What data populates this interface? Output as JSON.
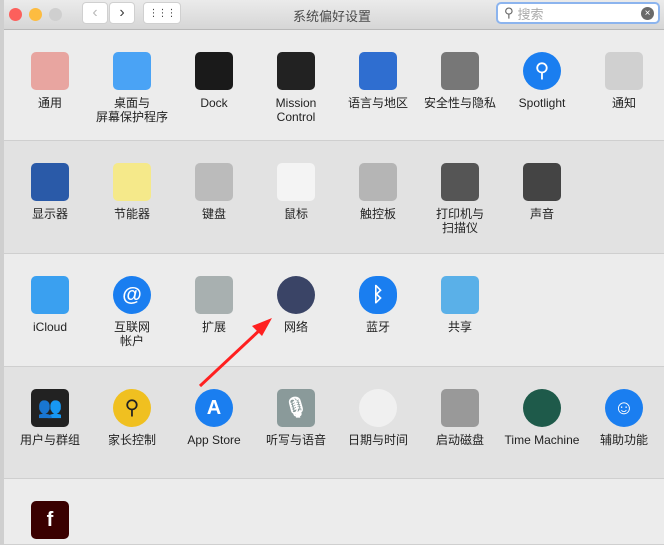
{
  "window": {
    "title": "系统偏好设置",
    "search_placeholder": "搜索",
    "back": "‹",
    "forward": "›",
    "grid": "⋮⋮⋮",
    "clear": "×"
  },
  "rows": [
    [
      {
        "label": "通用",
        "icon": "general-icon",
        "bg": "#e8a5a0"
      },
      {
        "label": "桌面与\n屏幕保护程序",
        "icon": "desktop-icon",
        "bg": "#4aa3f5"
      },
      {
        "label": "Dock",
        "icon": "dock-icon",
        "bg": "#1a1a1a"
      },
      {
        "label": "Mission\nControl",
        "icon": "mission-control-icon",
        "bg": "#222"
      },
      {
        "label": "语言与地区",
        "icon": "flag-icon",
        "bg": "#2f6ed0"
      },
      {
        "label": "安全性与隐私",
        "icon": "house-lock-icon",
        "bg": "#777"
      },
      {
        "label": "Spotlight",
        "icon": "magnifier-icon",
        "bg": "#1a7ef0"
      },
      {
        "label": "通知",
        "icon": "notification-icon",
        "bg": "#d0d0d0"
      }
    ],
    [
      {
        "label": "显示器",
        "icon": "display-icon",
        "bg": "#2a5aa8"
      },
      {
        "label": "节能器",
        "icon": "bulb-icon",
        "bg": "#f5e98a"
      },
      {
        "label": "键盘",
        "icon": "keyboard-icon",
        "bg": "#bbb"
      },
      {
        "label": "鼠标",
        "icon": "mouse-icon",
        "bg": "#f4f4f4"
      },
      {
        "label": "触控板",
        "icon": "trackpad-icon",
        "bg": "#b5b5b5"
      },
      {
        "label": "打印机与\n扫描仪",
        "icon": "printer-icon",
        "bg": "#555"
      },
      {
        "label": "声音",
        "icon": "speaker-icon",
        "bg": "#444"
      }
    ],
    [
      {
        "label": "iCloud",
        "icon": "cloud-icon",
        "bg": "#3aa0f0"
      },
      {
        "label": "互联网\n帐户",
        "icon": "at-icon",
        "bg": "#1a7ef0"
      },
      {
        "label": "扩展",
        "icon": "puzzle-icon",
        "bg": "#a8b0b0"
      },
      {
        "label": "网络",
        "icon": "globe-icon",
        "bg": "#3a4466"
      },
      {
        "label": "蓝牙",
        "icon": "bluetooth-icon",
        "bg": "#1a7ef0"
      },
      {
        "label": "共享",
        "icon": "sharing-folder-icon",
        "bg": "#5ab0e8"
      }
    ],
    [
      {
        "label": "用户与群组",
        "icon": "users-icon",
        "bg": "#222"
      },
      {
        "label": "家长控制",
        "icon": "parental-icon",
        "bg": "#f0c020"
      },
      {
        "label": "App Store",
        "icon": "app-store-icon",
        "bg": "#1a7ef0"
      },
      {
        "label": "听写与语音",
        "icon": "microphone-icon",
        "bg": "#8a9a9a"
      },
      {
        "label": "日期与时间",
        "icon": "clock-icon",
        "bg": "#f0f0f0"
      },
      {
        "label": "启动磁盘",
        "icon": "disk-icon",
        "bg": "#999"
      },
      {
        "label": "Time Machine",
        "icon": "time-machine-icon",
        "bg": "#1e5a4a"
      },
      {
        "label": "辅助功能",
        "icon": "accessibility-icon",
        "bg": "#1a7ef0"
      }
    ],
    [
      {
        "label": "",
        "icon": "flash-icon",
        "bg": "#3a0000"
      }
    ]
  ],
  "glyphs": {
    "magnifier-icon": "⚲",
    "at-icon": "@",
    "bluetooth-icon": "ᛒ",
    "flash-icon": "f",
    "accessibility-icon": "☺",
    "microphone-icon": "🎙",
    "users-icon": "👥",
    "parental-icon": "⚲",
    "app-store-icon": "A"
  },
  "annotation": {
    "arrow_color": "#ff2020"
  }
}
